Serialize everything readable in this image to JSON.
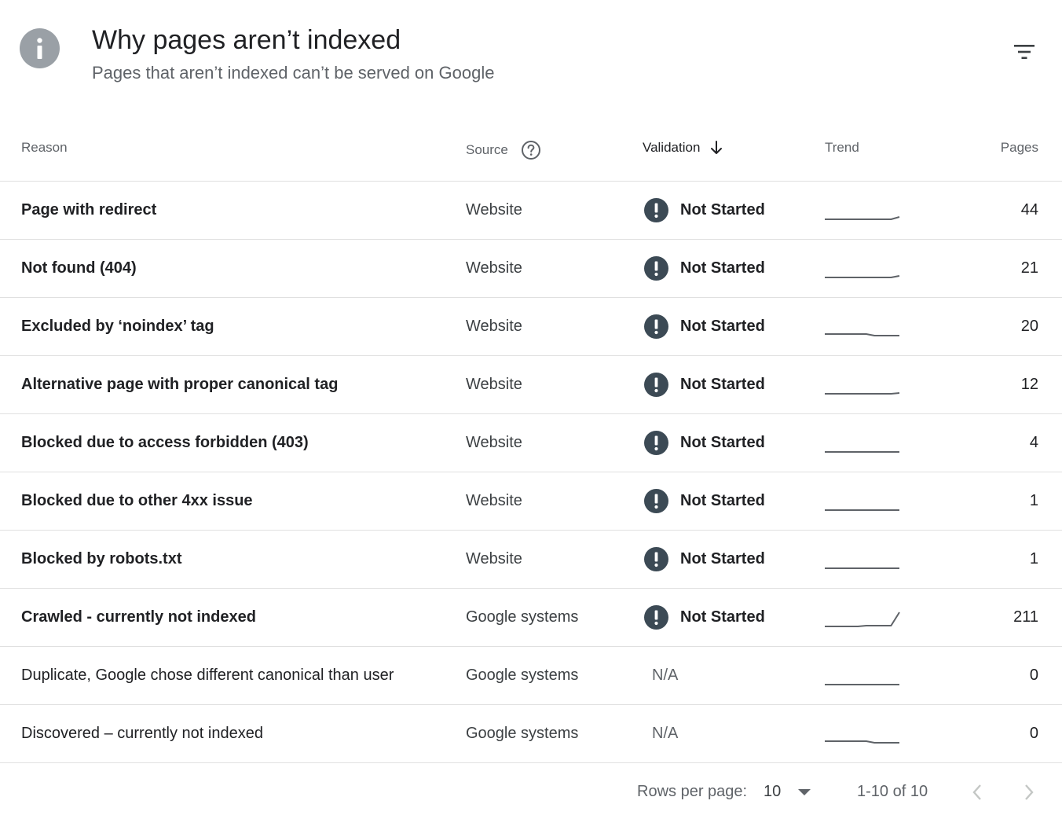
{
  "header": {
    "title": "Why pages aren’t indexed",
    "subtitle": "Pages that aren’t indexed can’t be served on Google"
  },
  "columns": {
    "reason": "Reason",
    "source": "Source",
    "validation": "Validation",
    "trend": "Trend",
    "pages": "Pages"
  },
  "rows": [
    {
      "reason": "Page with redirect",
      "source": "Website",
      "validation": "Not Started",
      "pages": "44",
      "bold": true,
      "trend": [
        0,
        0,
        0,
        0,
        0,
        0,
        0,
        0,
        0,
        3
      ]
    },
    {
      "reason": "Not found (404)",
      "source": "Website",
      "validation": "Not Started",
      "pages": "21",
      "bold": true,
      "trend": [
        0,
        0,
        0,
        0,
        0,
        0,
        0,
        0,
        0,
        2
      ]
    },
    {
      "reason": "Excluded by ‘noindex’ tag",
      "source": "Website",
      "validation": "Not Started",
      "pages": "20",
      "bold": true,
      "trend": [
        2,
        2,
        2,
        2,
        2,
        2,
        0,
        0,
        0,
        0
      ]
    },
    {
      "reason": "Alternative page with proper canonical tag",
      "source": "Website",
      "validation": "Not Started",
      "pages": "12",
      "bold": true,
      "trend": [
        0,
        0,
        0,
        0,
        0,
        0,
        0,
        0,
        0,
        1
      ]
    },
    {
      "reason": "Blocked due to access forbidden (403)",
      "source": "Website",
      "validation": "Not Started",
      "pages": "4",
      "bold": true,
      "trend": [
        0,
        0,
        0,
        0,
        0,
        0,
        0,
        0,
        0,
        0
      ]
    },
    {
      "reason": "Blocked due to other 4xx issue",
      "source": "Website",
      "validation": "Not Started",
      "pages": "1",
      "bold": true,
      "trend": [
        0,
        0,
        0,
        0,
        0,
        0,
        0,
        0,
        0,
        0
      ]
    },
    {
      "reason": "Blocked by robots.txt",
      "source": "Website",
      "validation": "Not Started",
      "pages": "1",
      "bold": true,
      "trend": [
        0,
        0,
        0,
        0,
        0,
        0,
        0,
        0,
        0,
        0
      ]
    },
    {
      "reason": "Crawled - currently not indexed",
      "source": "Google systems",
      "validation": "Not Started",
      "pages": "211",
      "bold": true,
      "trend": [
        0,
        0,
        0,
        0,
        0,
        1,
        1,
        1,
        1,
        18
      ]
    },
    {
      "reason": "Duplicate, Google chose different canonical than user",
      "source": "Google systems",
      "validation": "N/A",
      "pages": "0",
      "bold": false,
      "trend": [
        0,
        0,
        0,
        0,
        0,
        0,
        0,
        0,
        0,
        0
      ]
    },
    {
      "reason": "Discovered – currently not indexed",
      "source": "Google systems",
      "validation": "N/A",
      "pages": "0",
      "bold": false,
      "trend": [
        2,
        2,
        2,
        2,
        2,
        2,
        0,
        0,
        0,
        0
      ]
    }
  ],
  "footer": {
    "rows_per_page_label": "Rows per page:",
    "rows_per_page_value": "10",
    "range": "1-10 of 10"
  },
  "colors": {
    "warning_icon": "#3c4a55",
    "info_icon": "#9aa0a6",
    "trend_line": "#5f6368"
  },
  "icons": {
    "info": "info-icon",
    "filter": "filter-icon",
    "help": "help-circle-icon",
    "sort": "arrow-down-icon",
    "warning": "exclamation-icon",
    "dropdown": "caret-down-icon",
    "prev": "chevron-left-icon",
    "next": "chevron-right-icon"
  }
}
